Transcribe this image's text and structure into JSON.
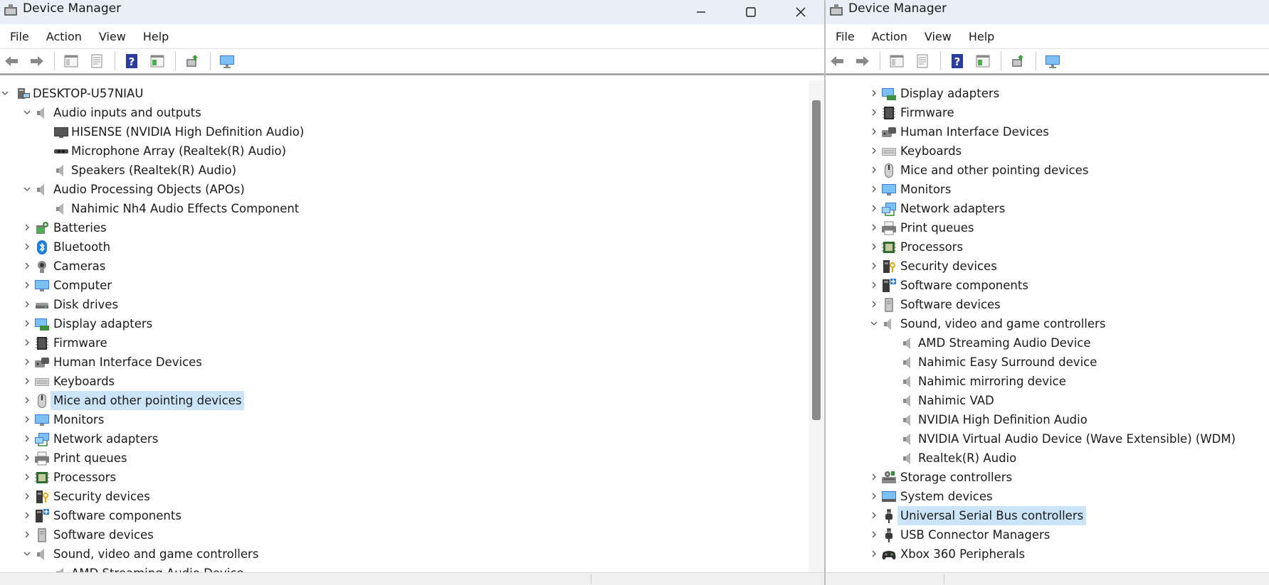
{
  "left_window": {
    "title": "Device Manager",
    "menus": [
      "File",
      "Action",
      "View",
      "Help"
    ],
    "toolbar_icons": [
      "back-arrow-icon",
      "forward-arrow-icon",
      "show-hide-console-tree-icon",
      "properties-icon",
      "help-icon",
      "update-driver-icon",
      "scan-hardware-icon",
      "computer-display-icon"
    ],
    "rows": [
      {
        "label": "DESKTOP-U57NIAU",
        "level": 0,
        "expand": "down",
        "icon": "computer-root"
      },
      {
        "label": "Audio inputs and outputs",
        "level": 1,
        "expand": "down",
        "icon": "speaker"
      },
      {
        "label": "HISENSE (NVIDIA High Definition Audio)",
        "level": 2,
        "expand": "none",
        "icon": "tv"
      },
      {
        "label": "Microphone Array (Realtek(R) Audio)",
        "level": 2,
        "expand": "none",
        "icon": "microphone"
      },
      {
        "label": "Speakers (Realtek(R) Audio)",
        "level": 2,
        "expand": "none",
        "icon": "speaker"
      },
      {
        "label": "Audio Processing Objects (APOs)",
        "level": 1,
        "expand": "down",
        "icon": "speaker"
      },
      {
        "label": "Nahimic Nh4 Audio Effects Component",
        "level": 2,
        "expand": "none",
        "icon": "speaker"
      },
      {
        "label": "Batteries",
        "level": 1,
        "expand": "right",
        "icon": "battery"
      },
      {
        "label": "Bluetooth",
        "level": 1,
        "expand": "right",
        "icon": "bluetooth"
      },
      {
        "label": "Cameras",
        "level": 1,
        "expand": "right",
        "icon": "camera"
      },
      {
        "label": "Computer",
        "level": 1,
        "expand": "right",
        "icon": "monitor"
      },
      {
        "label": "Disk drives",
        "level": 1,
        "expand": "right",
        "icon": "disk"
      },
      {
        "label": "Display adapters",
        "level": 1,
        "expand": "right",
        "icon": "display-adapter"
      },
      {
        "label": "Firmware",
        "level": 1,
        "expand": "right",
        "icon": "firmware"
      },
      {
        "label": "Human Interface Devices",
        "level": 1,
        "expand": "right",
        "icon": "hid"
      },
      {
        "label": "Keyboards",
        "level": 1,
        "expand": "right",
        "icon": "keyboard"
      },
      {
        "label": "Mice and other pointing devices",
        "level": 1,
        "expand": "right",
        "icon": "mouse",
        "selected": true
      },
      {
        "label": "Monitors",
        "level": 1,
        "expand": "right",
        "icon": "monitor"
      },
      {
        "label": "Network adapters",
        "level": 1,
        "expand": "right",
        "icon": "network"
      },
      {
        "label": "Print queues",
        "level": 1,
        "expand": "right",
        "icon": "printer"
      },
      {
        "label": "Processors",
        "level": 1,
        "expand": "right",
        "icon": "processor"
      },
      {
        "label": "Security devices",
        "level": 1,
        "expand": "right",
        "icon": "security"
      },
      {
        "label": "Software components",
        "level": 1,
        "expand": "right",
        "icon": "software-component"
      },
      {
        "label": "Software devices",
        "level": 1,
        "expand": "right",
        "icon": "software-device"
      },
      {
        "label": "Sound, video and game controllers",
        "level": 1,
        "expand": "down",
        "icon": "speaker"
      },
      {
        "label": "AMD Streaming Audio Device",
        "level": 2,
        "expand": "none",
        "icon": "speaker"
      }
    ]
  },
  "right_window": {
    "title": "Device Manager",
    "menus": [
      "File",
      "Action",
      "View",
      "Help"
    ],
    "toolbar_icons": [
      "back-arrow-icon",
      "forward-arrow-icon",
      "show-hide-console-tree-icon",
      "properties-icon",
      "help-icon",
      "update-driver-icon",
      "scan-hardware-icon",
      "computer-display-icon"
    ],
    "rows": [
      {
        "label": "Display adapters",
        "level": 1,
        "expand": "right",
        "icon": "display-adapter"
      },
      {
        "label": "Firmware",
        "level": 1,
        "expand": "right",
        "icon": "firmware"
      },
      {
        "label": "Human Interface Devices",
        "level": 1,
        "expand": "right",
        "icon": "hid"
      },
      {
        "label": "Keyboards",
        "level": 1,
        "expand": "right",
        "icon": "keyboard"
      },
      {
        "label": "Mice and other pointing devices",
        "level": 1,
        "expand": "right",
        "icon": "mouse"
      },
      {
        "label": "Monitors",
        "level": 1,
        "expand": "right",
        "icon": "monitor"
      },
      {
        "label": "Network adapters",
        "level": 1,
        "expand": "right",
        "icon": "network"
      },
      {
        "label": "Print queues",
        "level": 1,
        "expand": "right",
        "icon": "printer"
      },
      {
        "label": "Processors",
        "level": 1,
        "expand": "right",
        "icon": "processor"
      },
      {
        "label": "Security devices",
        "level": 1,
        "expand": "right",
        "icon": "security"
      },
      {
        "label": "Software components",
        "level": 1,
        "expand": "right",
        "icon": "software-component"
      },
      {
        "label": "Software devices",
        "level": 1,
        "expand": "right",
        "icon": "software-device"
      },
      {
        "label": "Sound, video and game controllers",
        "level": 1,
        "expand": "down",
        "icon": "speaker"
      },
      {
        "label": "AMD Streaming Audio Device",
        "level": 2,
        "expand": "none",
        "icon": "speaker"
      },
      {
        "label": "Nahimic Easy Surround device",
        "level": 2,
        "expand": "none",
        "icon": "speaker"
      },
      {
        "label": "Nahimic mirroring device",
        "level": 2,
        "expand": "none",
        "icon": "speaker"
      },
      {
        "label": "Nahimic VAD",
        "level": 2,
        "expand": "none",
        "icon": "speaker"
      },
      {
        "label": "NVIDIA High Definition Audio",
        "level": 2,
        "expand": "none",
        "icon": "speaker"
      },
      {
        "label": "NVIDIA Virtual Audio Device (Wave Extensible) (WDM)",
        "level": 2,
        "expand": "none",
        "icon": "speaker"
      },
      {
        "label": "Realtek(R) Audio",
        "level": 2,
        "expand": "none",
        "icon": "speaker"
      },
      {
        "label": "Storage controllers",
        "level": 1,
        "expand": "right",
        "icon": "storage-controller"
      },
      {
        "label": "System devices",
        "level": 1,
        "expand": "right",
        "icon": "system-device"
      },
      {
        "label": "Universal Serial Bus controllers",
        "level": 1,
        "expand": "right",
        "icon": "usb",
        "selected": true
      },
      {
        "label": "USB Connector Managers",
        "level": 1,
        "expand": "right",
        "icon": "usb"
      },
      {
        "label": "Xbox 360 Peripherals",
        "level": 1,
        "expand": "right",
        "icon": "gamepad"
      }
    ]
  },
  "colors": {
    "selection": "#cce4f7",
    "titlebar": "#e9eff7",
    "scroll_thumb": "#8a8a8a"
  }
}
